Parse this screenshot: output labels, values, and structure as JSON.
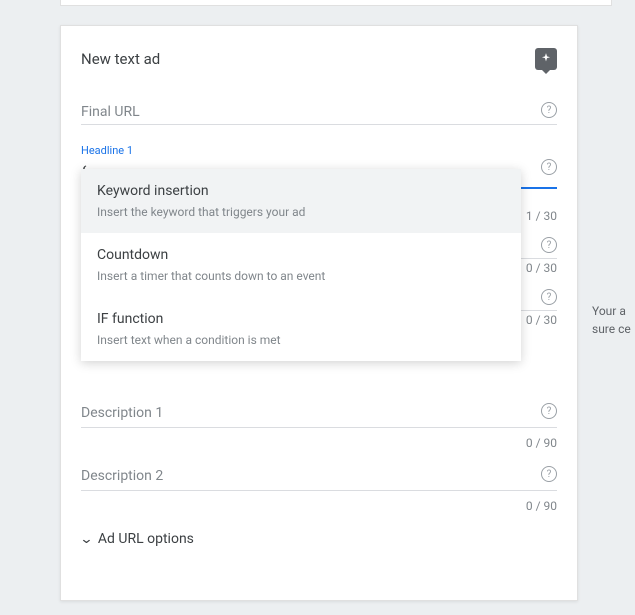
{
  "card": {
    "title": "New text ad"
  },
  "fields": {
    "final_url": {
      "label": "Final URL"
    },
    "headline1": {
      "label": "Headline 1",
      "value": "{",
      "counter": "1 / 30"
    },
    "headline2": {
      "counter": "0 / 30"
    },
    "headline3": {
      "counter": "0 / 30"
    },
    "description1": {
      "label": "Description 1",
      "counter": "0 / 90"
    },
    "description2": {
      "label": "Description 2",
      "counter": "0 / 90"
    }
  },
  "dropdown": {
    "items": [
      {
        "title": "Keyword insertion",
        "desc": "Insert the keyword that triggers your ad"
      },
      {
        "title": "Countdown",
        "desc": "Insert a timer that counts down to an event"
      },
      {
        "title": "IF function",
        "desc": "Insert text when a condition is met"
      }
    ]
  },
  "url_options": {
    "label": "Ad URL options"
  },
  "right_panel": {
    "line1": "Your a",
    "line2": "sure ce"
  }
}
